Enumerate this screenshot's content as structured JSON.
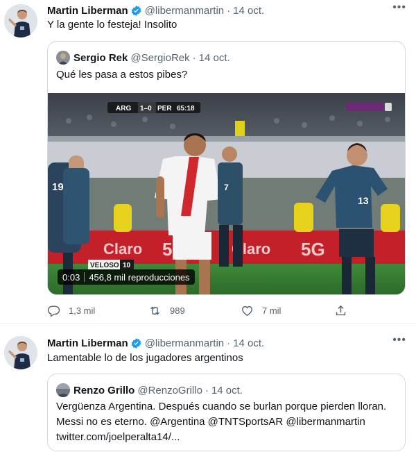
{
  "tweets": [
    {
      "author": {
        "name": "Martin Liberman",
        "handle": "@libermanmartin",
        "verified": true
      },
      "separator": "·",
      "date": "14 oct.",
      "more_icon": "more-dots-icon",
      "text": "Y la gente lo festeja! Insolito",
      "quote": {
        "author": {
          "name": "Sergio Rek",
          "handle": "@SergioRek"
        },
        "separator": "·",
        "date": "14 oct.",
        "text": "Qué les pasa a estos pibes?",
        "media": {
          "type": "video",
          "duration": "0:03",
          "views": "456,8 mil reproducciones",
          "scoreboard": {
            "team1": "ARG",
            "score": "1–0",
            "team2": "PER",
            "clock": "65:18"
          },
          "overlay_brand": "VELOSO",
          "overlay_number": "10",
          "ad_texts": [
            "Claro",
            "5G",
            "Claro",
            "5G"
          ],
          "player_numbers": [
            "19",
            "7",
            "13"
          ]
        }
      },
      "actions": {
        "reply": "1,3 mil",
        "retweet": "989",
        "like": "7 mil"
      }
    },
    {
      "author": {
        "name": "Martin Liberman",
        "handle": "@libermanmartin",
        "verified": true
      },
      "separator": "·",
      "date": "14 oct.",
      "more_icon": "more-dots-icon",
      "text": "Lamentable lo de los jugadores argentinos",
      "quote": {
        "author": {
          "name": "Renzo Grillo",
          "handle": "@RenzoGrillo"
        },
        "separator": "·",
        "date": "14 oct.",
        "text_lines": [
          "Vergüenza Argentina. Después cuando se burlan porque pierden lloran.",
          "Messi no es eterno. @Argentina @TNTSportsAR @libermanmartin",
          "twitter.com/joelperalta14/..."
        ]
      }
    }
  ],
  "colors": {
    "text_primary": "#0f1419",
    "text_secondary": "#536471",
    "verified_blue": "#1d9bf0",
    "border": "#cfd9de"
  }
}
